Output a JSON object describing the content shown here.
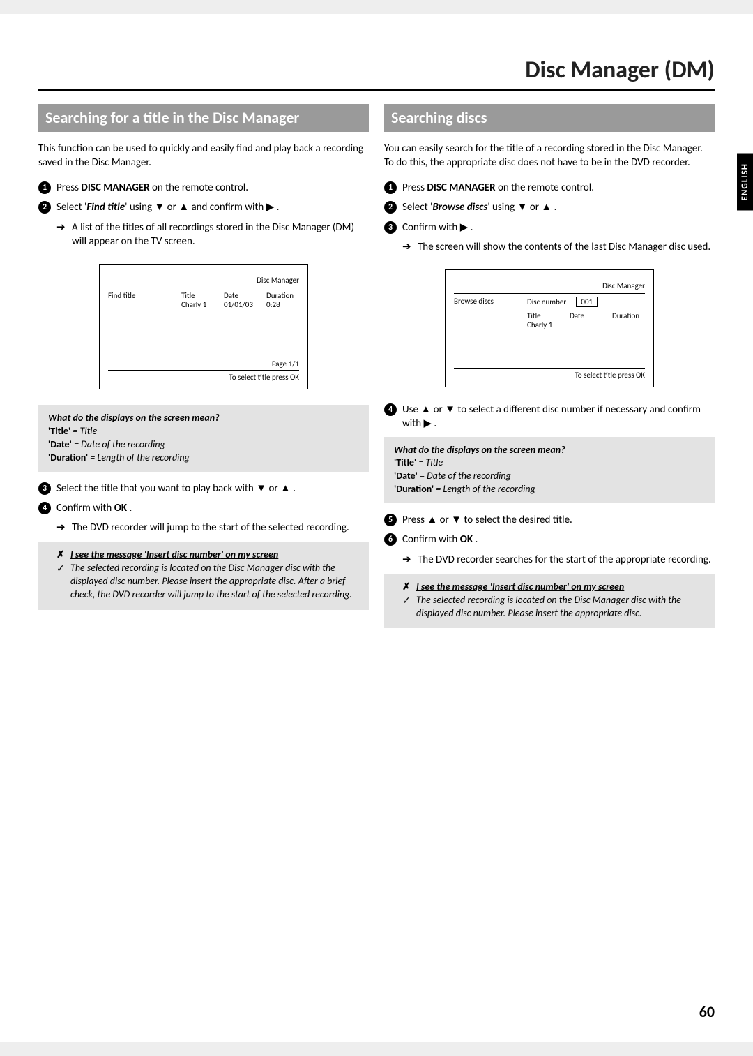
{
  "page_title": "Disc Manager (DM)",
  "language_tab": "ENGLISH",
  "page_number": "60",
  "icons": {
    "down": "▼",
    "up": "▲",
    "right": "▶"
  },
  "left": {
    "header": "Searching for a title in the Disc Manager",
    "intro": "This function can be used to quickly and easily find and play back a recording saved in the Disc Manager.",
    "step1_a": "Press  ",
    "step1_bold": "DISC MANAGER",
    "step1_b": " on the remote control.",
    "step2_a": "Select '",
    "step2_bolditalic": "Find title",
    "step2_b": "' using  ",
    "step2_c": "  or  ",
    "step2_d": "  and confirm with  ",
    "step2_e": " .",
    "step2_sub": "A list of the titles of all recordings stored in the Disc Manager (DM) will appear on the TV screen.",
    "screen": {
      "dm_label": "Disc Manager",
      "left_label": "Find title",
      "col1": "Title",
      "col2": "Date",
      "col3": "Duration",
      "d1": "Charly 1",
      "d2": "01/01/03",
      "d3": "0:28",
      "footer1": "Page 1/1",
      "footer2": "To select title press OK"
    },
    "info": {
      "q": "What do the displays on the screen mean?",
      "l1b": "'Title'",
      "l1": " = Title",
      "l2b": "'Date'",
      "l2": " = Date of the recording",
      "l3b": "'Duration'",
      "l3": " = Length of the recording"
    },
    "step3_a": "Select the title that you want to play back with  ",
    "step3_b": "  or  ",
    "step3_c": " .",
    "step4_a": "Confirm with  ",
    "step4_bold": "OK",
    "step4_b": " .",
    "step4_sub": "The DVD recorder will jump to the start of the selected recording.",
    "tip": {
      "x": "✗",
      "xline_a": "I see the message '",
      "xline_b": "Insert disc number",
      "xline_c": "' on my screen",
      "chk": "✓",
      "chkline": "The selected recording is located on the Disc Manager disc with the displayed disc number. Please insert the appropriate disc. After a brief check, the DVD recorder will jump to the start of the selected recording."
    }
  },
  "right": {
    "header": "Searching discs",
    "intro": "You can easily search for the title of a recording stored in the Disc Manager. To do this, the appropriate disc does not have to be in the DVD recorder.",
    "step1_a": "Press  ",
    "step1_bold": "DISC MANAGER",
    "step1_b": " on the remote control.",
    "step2_a": "Select '",
    "step2_bolditalic": "Browse discs",
    "step2_b": "' using  ",
    "step2_c": "  or  ",
    "step2_d": " .",
    "step3_a": "Confirm with  ",
    "step3_b": " .",
    "step3_sub": "The screen will show the contents of the last Disc Manager disc used.",
    "screen": {
      "dm_label": "Disc Manager",
      "left_label": "Browse discs",
      "discnum_label": "Disc number",
      "discnum_val": "001",
      "col1": "Title",
      "col2": "Date",
      "col3": "Duration",
      "d1": "Charly 1",
      "footer2": "To select title press OK"
    },
    "step4_a": "Use  ",
    "step4_b": "  or  ",
    "step4_c": "  to select a different disc number if necessary and confirm with  ",
    "step4_d": " .",
    "info": {
      "q": "What do the displays on the screen mean?",
      "l1b": "'Title'",
      "l1": " = Title",
      "l2b": "'Date'",
      "l2": " = Date of the recording",
      "l3b": "'Duration'",
      "l3": " = Length of the recording"
    },
    "step5_a": "Press  ",
    "step5_b": "  or  ",
    "step5_c": "  to select the desired title.",
    "step6_a": "Confirm with  ",
    "step6_bold": "OK",
    "step6_b": " .",
    "step6_sub": "The DVD recorder searches for the start of the appropriate recording.",
    "tip": {
      "x": "✗",
      "xline_a": "I see the message '",
      "xline_b": "Insert disc number",
      "xline_c": "' on my screen",
      "chk": "✓",
      "chkline": "The selected recording is located on the Disc Manager disc with the displayed disc number. Please insert the appropriate disc."
    }
  }
}
